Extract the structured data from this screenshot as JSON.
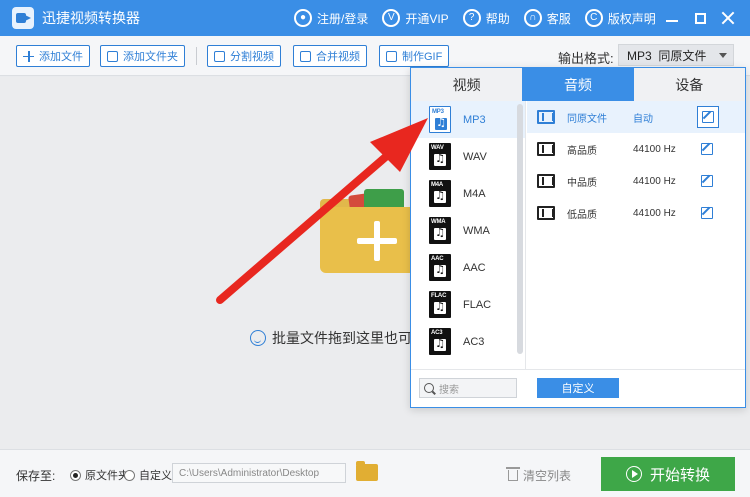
{
  "app": {
    "title": "迅捷视频转换器"
  },
  "top_links": [
    {
      "label": "注册/登录",
      "icon": "user-icon"
    },
    {
      "label": "开通VIP",
      "icon": "vip-icon"
    },
    {
      "label": "帮助",
      "icon": "help-icon"
    },
    {
      "label": "客服",
      "icon": "headset-icon"
    },
    {
      "label": "版权声明",
      "icon": "copyright-icon"
    }
  ],
  "toolbar": {
    "add_file": "添加文件",
    "add_folder": "添加文件夹",
    "split_video": "分割视频",
    "merge_video": "合并视频",
    "make_gif": "制作GIF",
    "output_format_label": "输出格式:",
    "output_format_value": "MP3  同原文件"
  },
  "main": {
    "drop_hint": "批量文件拖到这里也可以"
  },
  "popup": {
    "tabs": [
      "视频",
      "音频",
      "设备"
    ],
    "active_tab": "音频",
    "formats": [
      {
        "label": "MP3",
        "tag": "MP3"
      },
      {
        "label": "WAV",
        "tag": "WAV"
      },
      {
        "label": "M4A",
        "tag": "M4A"
      },
      {
        "label": "WMA",
        "tag": "WMA"
      },
      {
        "label": "AAC",
        "tag": "AAC"
      },
      {
        "label": "FLAC",
        "tag": "FLAC"
      },
      {
        "label": "AC3",
        "tag": "AC3"
      }
    ],
    "active_format": "MP3",
    "qualities": [
      {
        "name": "同原文件",
        "rate": "自动"
      },
      {
        "name": "高品质",
        "rate": "44100 Hz"
      },
      {
        "name": "中品质",
        "rate": "44100 Hz"
      },
      {
        "name": "低品质",
        "rate": "44100 Hz"
      }
    ],
    "search_placeholder": "搜索",
    "custom_button": "自定义"
  },
  "bottom": {
    "save_to_label": "保存至:",
    "radio_original": "原文件夹",
    "radio_custom": "自定义",
    "path": "C:\\Users\\Administrator\\Desktop",
    "clear_list": "清空列表",
    "start": "开始转换"
  },
  "colors": {
    "accent": "#3a8ee6",
    "start": "#3ea748",
    "annotation_arrow": "#e8271f"
  }
}
